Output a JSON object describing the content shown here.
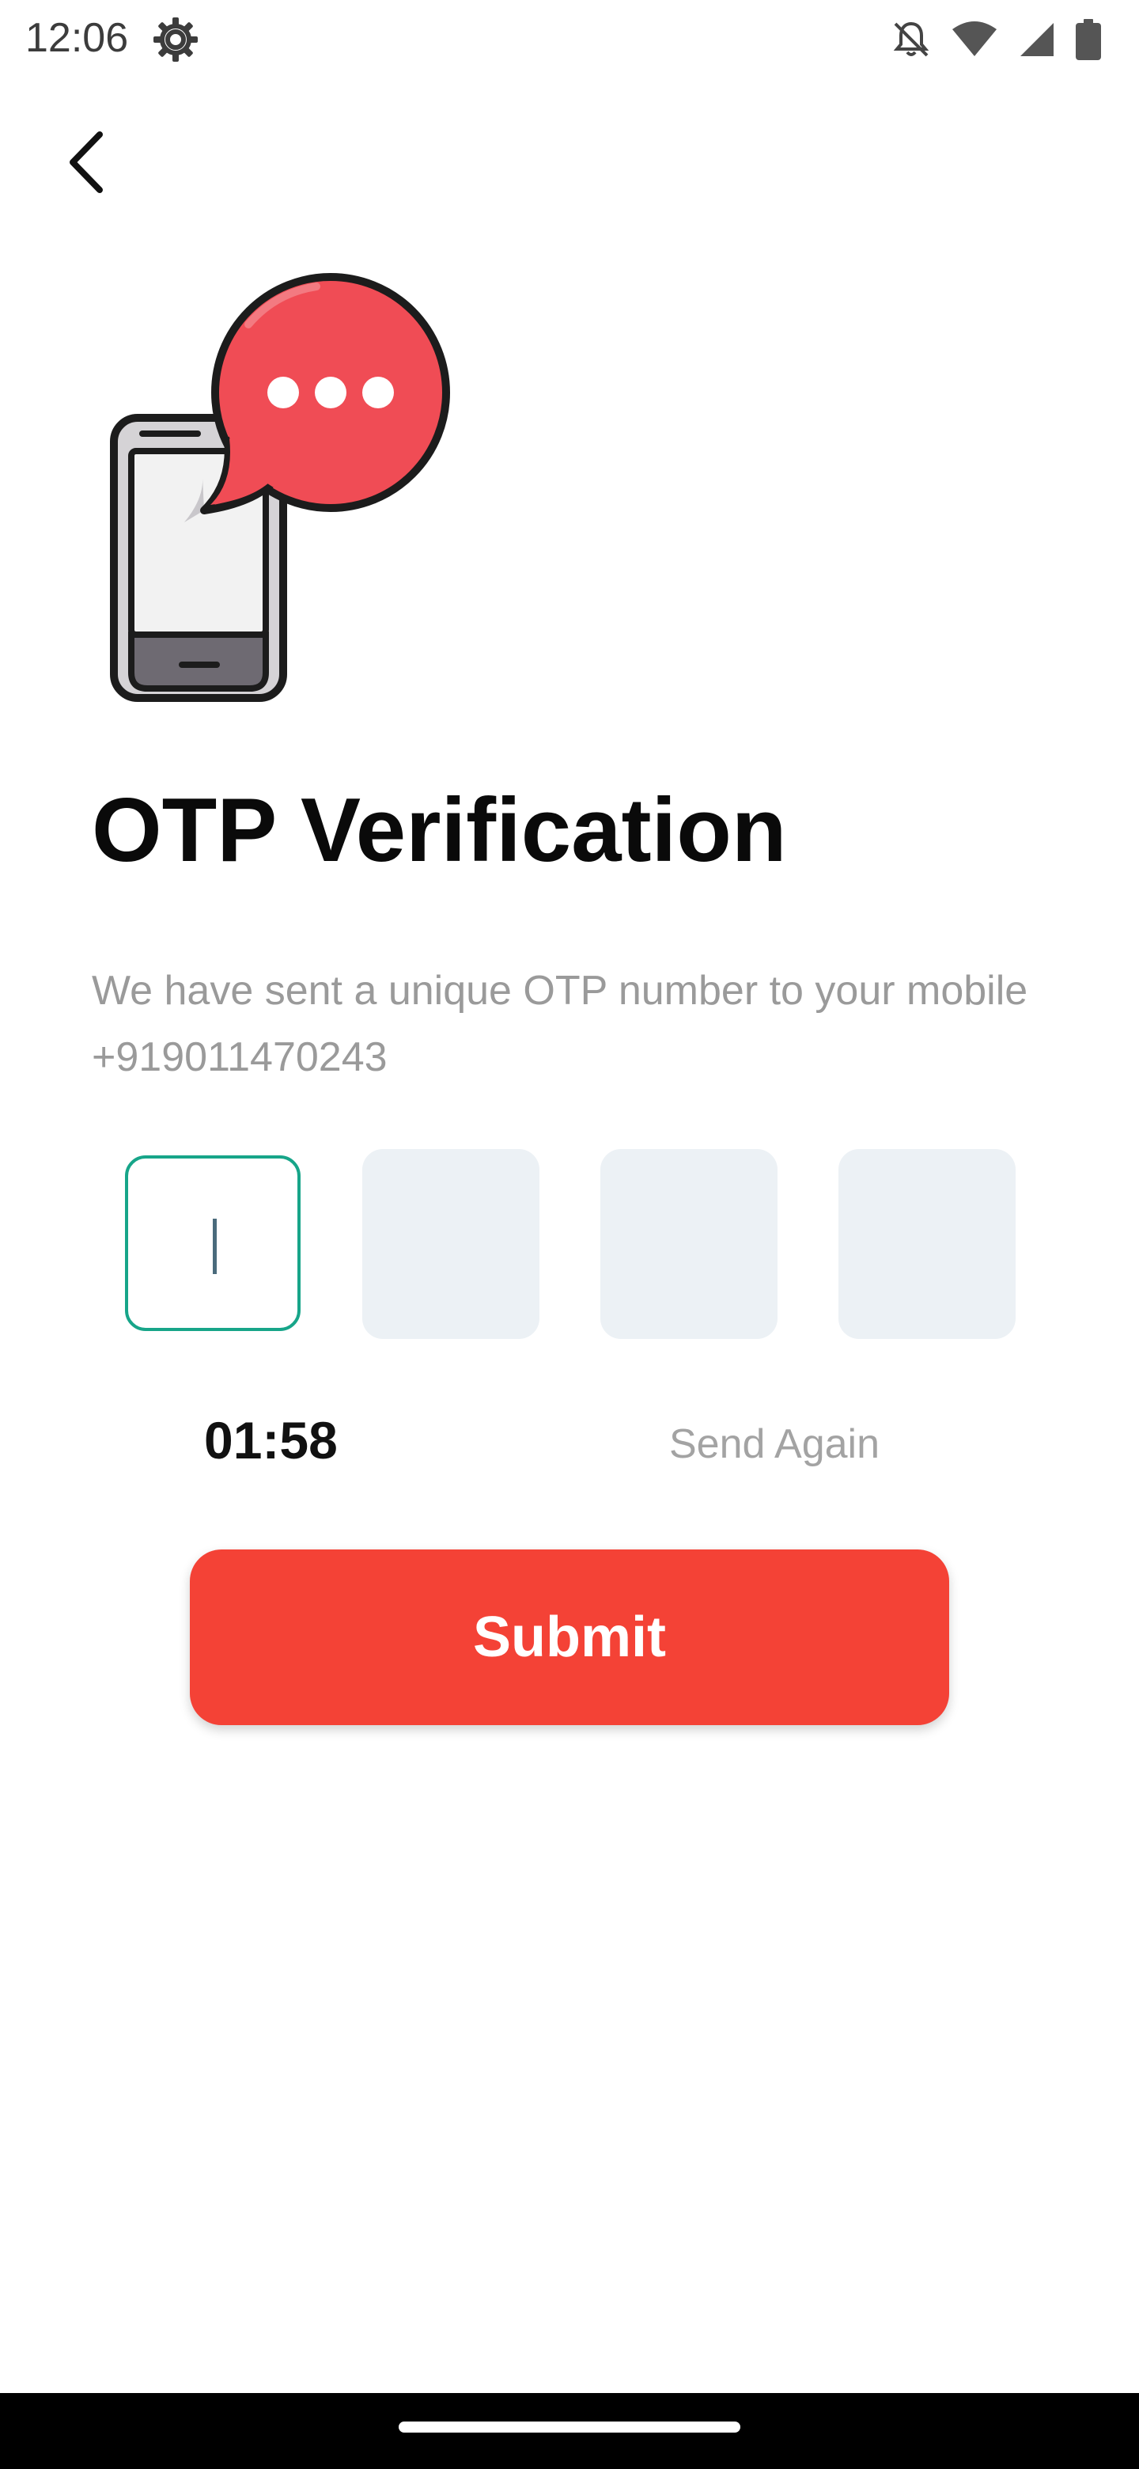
{
  "status_bar": {
    "time": "12:06",
    "icons": [
      "settings-gear-icon",
      "notifications-off-icon",
      "wifi-icon",
      "cellular-signal-icon",
      "battery-icon"
    ]
  },
  "header": {
    "back_icon": "chevron-left-icon"
  },
  "illustration": {
    "icon": "phone-chat-bubble-icon",
    "colors": {
      "bubble": "#f04c55",
      "outline": "#1c1c1c",
      "screen": "#f2f2f2",
      "phone_body": "#d5d3d6"
    }
  },
  "main": {
    "title": "OTP Verification",
    "subtitle": "We have sent a unique OTP number to your mobile +919011470243",
    "otp_digits": [
      "",
      "",
      "",
      ""
    ],
    "active_digit_index": 0,
    "timer": "01:58",
    "send_again_label": "Send Again",
    "submit_label": "Submit"
  },
  "colors": {
    "accent": "#f44236",
    "active_border": "#17a589",
    "box_fill": "#ecf1f5",
    "muted_text": "#9a9a9a"
  }
}
